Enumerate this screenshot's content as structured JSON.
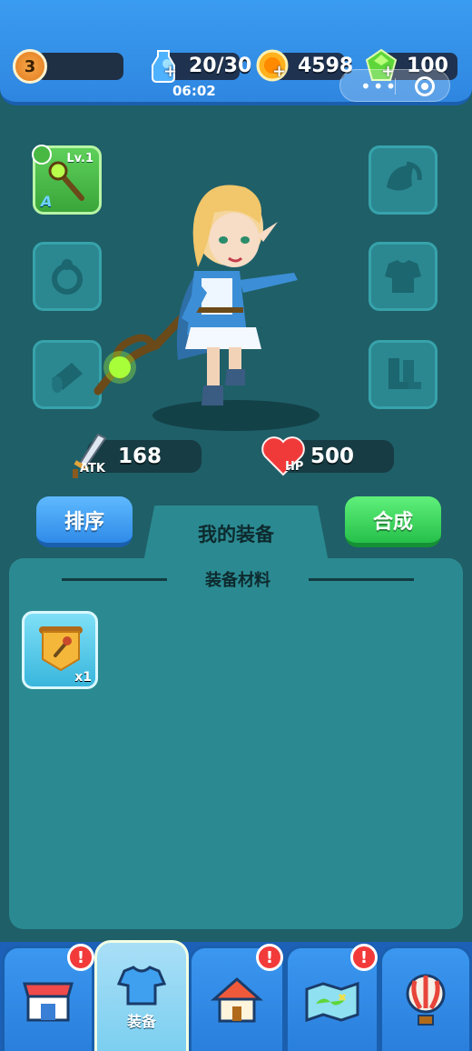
{
  "top": {
    "level": "3",
    "energy": "20/30",
    "energy_timer": "06:02",
    "gold": "4598",
    "gems": "100",
    "energy_icon": "energy-bottle-icon",
    "gold_icon": "gold-coin-icon",
    "gem_icon": "green-gem-icon"
  },
  "equipment": {
    "weapon": {
      "level": "Lv.1",
      "grade": "A",
      "icon": "staff-icon"
    },
    "empty_slots": [
      "hat-icon",
      "ring-icon",
      "armor-icon",
      "bracer-icon",
      "boots-icon"
    ]
  },
  "stats": {
    "atk_label": "ATK",
    "atk_value": "168",
    "hp_label": "HP",
    "hp_value": "500"
  },
  "actions": {
    "sort_label": "排序",
    "tab_label": "我的装备",
    "merge_label": "合成"
  },
  "inventory": {
    "section_title": "装备材料",
    "items": [
      {
        "icon": "staff-scroll-icon",
        "count": "x1"
      }
    ]
  },
  "nav": {
    "items": [
      {
        "icon": "shop-icon",
        "label": "",
        "alert": true
      },
      {
        "icon": "armor-icon",
        "label": "装备",
        "alert": false,
        "active": true
      },
      {
        "icon": "home-icon",
        "label": "",
        "alert": true
      },
      {
        "icon": "map-icon",
        "label": "",
        "alert": true
      },
      {
        "icon": "balloon-icon",
        "label": "",
        "alert": false
      }
    ],
    "alert_mark": "!"
  },
  "colors": {
    "background": "#1f5f68",
    "panel": "#2b8a91",
    "top_bar": "#3a9cf0",
    "sort_button": "#2f8be8",
    "merge_button": "#26c04a",
    "weapon_slot": "#4cbf48"
  }
}
